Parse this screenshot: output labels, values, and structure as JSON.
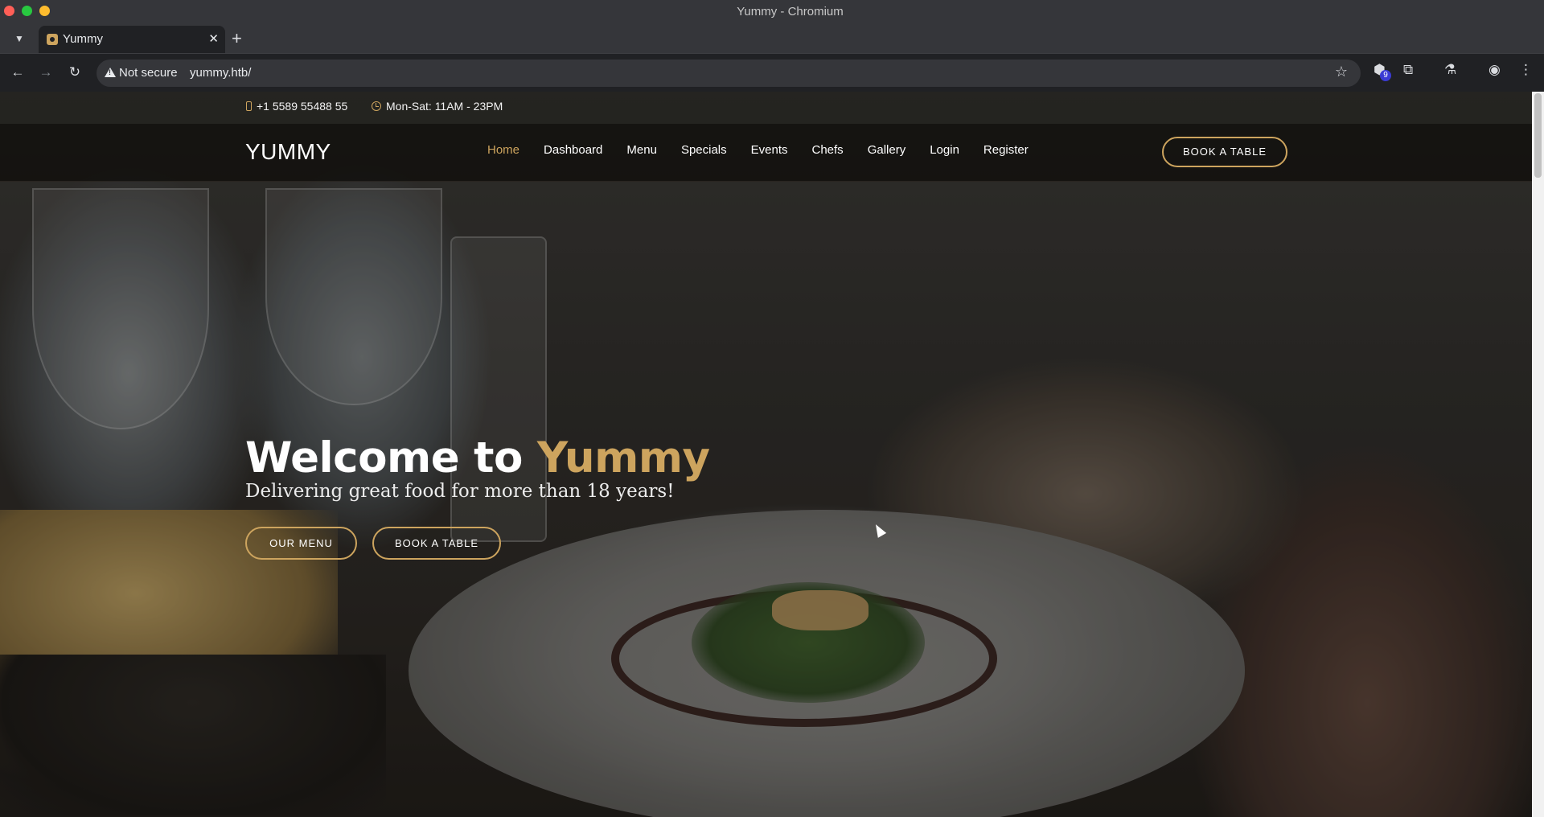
{
  "browser": {
    "window_title": "Yummy - Chromium",
    "tab": {
      "title": "Yummy",
      "close": "✕"
    },
    "new_tab": "+",
    "security_label": "Not secure",
    "url": "yummy.htb/",
    "extension_badge_count": "9"
  },
  "site": {
    "topbar": {
      "phone": "+1 5589 55488 55",
      "hours": "Mon-Sat: 11AM - 23PM"
    },
    "header": {
      "logo": "YUMMY",
      "nav": [
        "Home",
        "Dashboard",
        "Menu",
        "Specials",
        "Events",
        "Chefs",
        "Gallery",
        "Login",
        "Register"
      ],
      "active_nav": "Home",
      "book_button": "BOOK A TABLE"
    },
    "hero": {
      "title_prefix": "Welcome to ",
      "title_accent": "Yummy",
      "subtitle": "Delivering great food for more than 18 years!",
      "menu_button": "OUR MENU",
      "book_button": "BOOK A TABLE"
    }
  },
  "colors": {
    "accent": "#cda45e",
    "header_bg": "#0c0b09"
  },
  "icons": [
    "back-arrow-icon",
    "forward-arrow-icon",
    "reload-icon",
    "warning-icon",
    "star-icon",
    "extension-icon",
    "puzzle-icon",
    "labs-flask-icon",
    "profile-icon",
    "kebab-menu-icon",
    "phone-icon",
    "clock-icon"
  ]
}
